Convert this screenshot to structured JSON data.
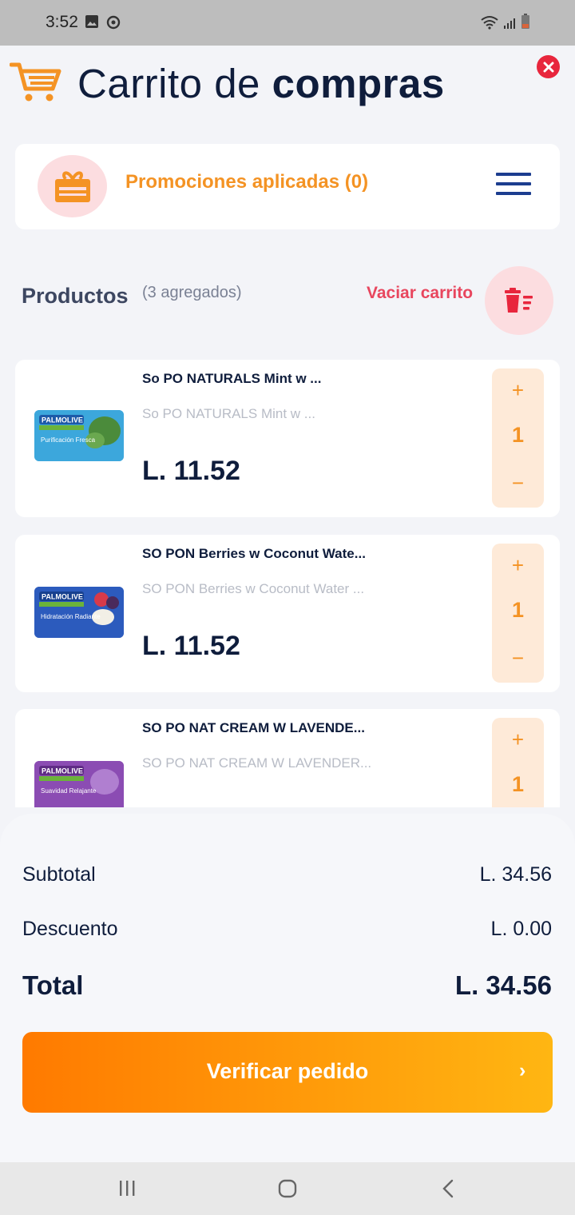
{
  "status_bar": {
    "time": "3:52"
  },
  "header": {
    "title_regular": "Carrito de",
    "title_bold": "compras"
  },
  "promotions": {
    "label": "Promociones aplicadas (0)"
  },
  "products_section": {
    "heading": "Productos",
    "count": "(3 agregados)",
    "clear_label": "Vaciar carrito"
  },
  "products": [
    {
      "name": "So PO NATURALS Mint w ...",
      "description": "So PO NATURALS Mint w ...",
      "price": "L. 11.52",
      "quantity": "1",
      "plus": "+",
      "minus": "−",
      "brand": "PALMOLIVE",
      "variant": "Purificación Fresca",
      "color": "#39a6dd"
    },
    {
      "name": "SO PON Berries w Coconut Wate...",
      "description": "SO PON Berries w Coconut Water ...",
      "price": "L. 11.52",
      "quantity": "1",
      "plus": "+",
      "minus": "−",
      "brand": "PALMOLIVE",
      "variant": "Hidratación Radiante",
      "color": "#2a56b8"
    },
    {
      "name": "SO PO NAT CREAM W LAVENDE...",
      "description": "SO PO NAT CREAM W LAVENDER...",
      "price": "",
      "quantity": "1",
      "plus": "+",
      "minus": "−",
      "brand": "PALMOLIVE",
      "variant": "Suavidad Relajante",
      "color": "#8a4ab0"
    }
  ],
  "summary": {
    "subtotal_label": "Subtotal",
    "subtotal_value": "L. 34.56",
    "discount_label": "Descuento",
    "discount_value": "L. 0.00",
    "total_label": "Total",
    "total_value": "L. 34.56"
  },
  "checkout": {
    "label": "Verificar pedido",
    "arrow": "›"
  },
  "colors": {
    "accent_orange": "#f49324",
    "danger": "#e8263d",
    "navy": "#0f1d3c",
    "menu_blue": "#1c3d8f"
  },
  "icons": [
    "gallery-icon",
    "sync-icon",
    "wifi-icon",
    "signal-icon",
    "battery-icon",
    "cart-icon",
    "close-icon",
    "gift-icon",
    "menu-icon",
    "trash-icon",
    "recent-apps-icon",
    "home-icon",
    "back-icon"
  ]
}
